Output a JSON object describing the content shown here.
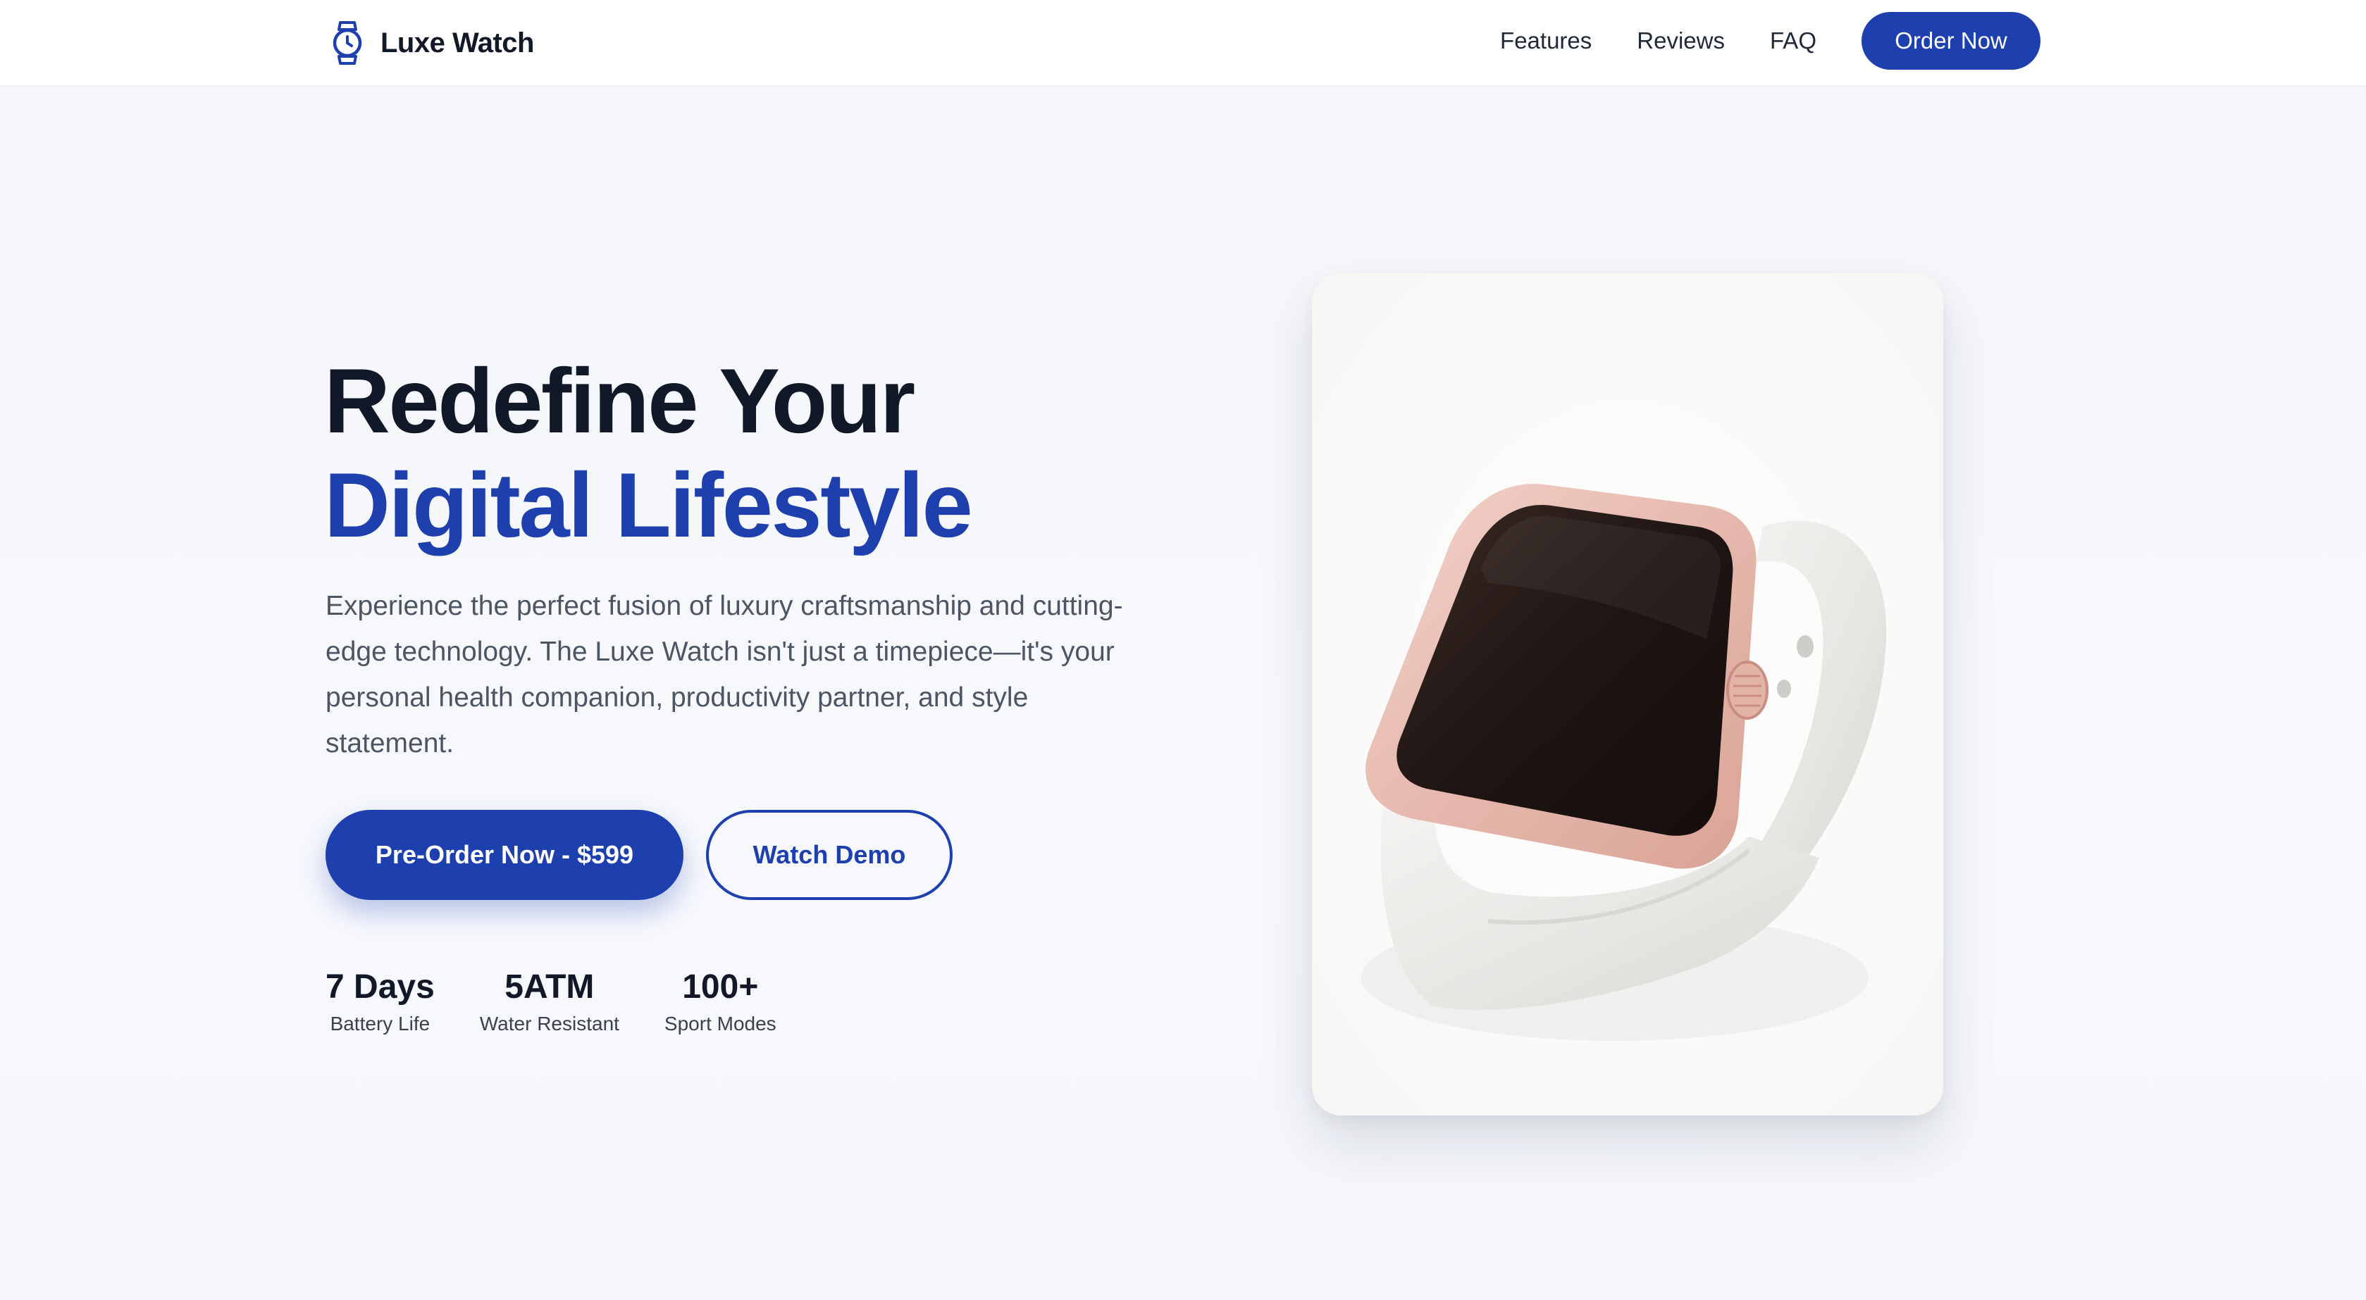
{
  "brand": {
    "name": "Luxe Watch",
    "icon": "watch-icon"
  },
  "nav": {
    "links": [
      "Features",
      "Reviews",
      "FAQ"
    ],
    "cta": "Order Now"
  },
  "hero": {
    "title_line1": "Redefine Your",
    "title_line2": "Digital Lifestyle",
    "description": "Experience the perfect fusion of luxury craftsmanship and cutting-edge technology. The Luxe Watch isn't just a timepiece—it's your personal health companion, productivity partner, and style statement.",
    "primary_cta": "Pre-Order Now - $599",
    "secondary_cta": "Watch Demo"
  },
  "stats": [
    {
      "value": "7 Days",
      "label": "Battery Life"
    },
    {
      "value": "5ATM",
      "label": "Water Resistant"
    },
    {
      "value": "100+",
      "label": "Sport Modes"
    }
  ],
  "colors": {
    "accent": "#1e40af",
    "heading": "#111827",
    "body_text": "#4b5563",
    "background": "#f5f7fb"
  }
}
